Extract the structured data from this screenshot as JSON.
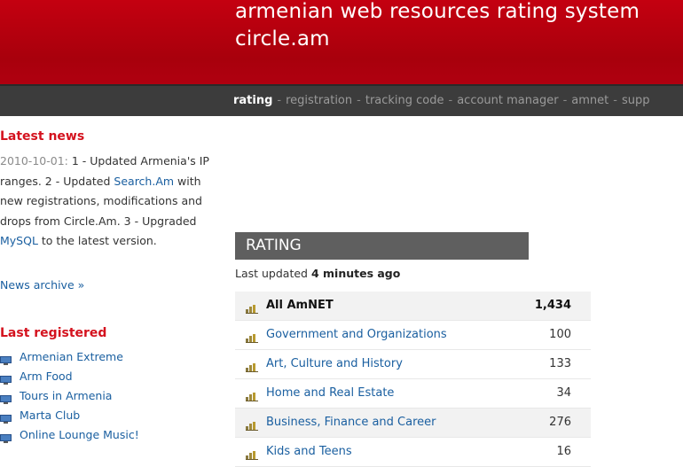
{
  "header": {
    "title_line1": "armenian web resources rating system",
    "title_line2": "circle.am"
  },
  "nav": {
    "items": [
      {
        "label": "rating",
        "active": true
      },
      {
        "label": "registration",
        "active": false
      },
      {
        "label": "tracking code",
        "active": false
      },
      {
        "label": "account manager",
        "active": false
      },
      {
        "label": "amnet",
        "active": false
      },
      {
        "label": "supp",
        "active": false
      }
    ],
    "separator": "-"
  },
  "news": {
    "heading": "Latest news",
    "date": "2010-10-01:",
    "text1": " 1 - Updated Armenia's IP ranges. 2 - Updated ",
    "link1": "Search.Am",
    "text2": " with new registrations, modifications and drops from Circle.Am. 3 - Upgraded ",
    "link2": "MySQL",
    "text3": " to the latest version.",
    "archive_link": "News archive »"
  },
  "last_registered": {
    "heading": "Last registered",
    "items": [
      "Armenian Extreme",
      "Arm Food",
      "Tours in Armenia",
      "Marta Club",
      "Online Lounge Music!"
    ],
    "icon": "monitor-icon"
  },
  "rating": {
    "header": "RATING",
    "updated_prefix": "Last updated ",
    "updated_value": "4 minutes ago",
    "rows": [
      {
        "name": "All AmNET",
        "count": "1,434"
      },
      {
        "name": "Government and Organizations",
        "count": "100"
      },
      {
        "name": "Art, Culture and History",
        "count": "133"
      },
      {
        "name": "Home and Real Estate",
        "count": "34"
      },
      {
        "name": "Business, Finance and Career",
        "count": "276"
      },
      {
        "name": "Kids and Teens",
        "count": "16"
      }
    ],
    "row_icon": "bar-chart-icon"
  },
  "colors": {
    "header_red": "#b8000e",
    "nav_dark": "#3c3c3c",
    "accent_red": "#d4121e",
    "link_blue": "#1a5fa0"
  }
}
